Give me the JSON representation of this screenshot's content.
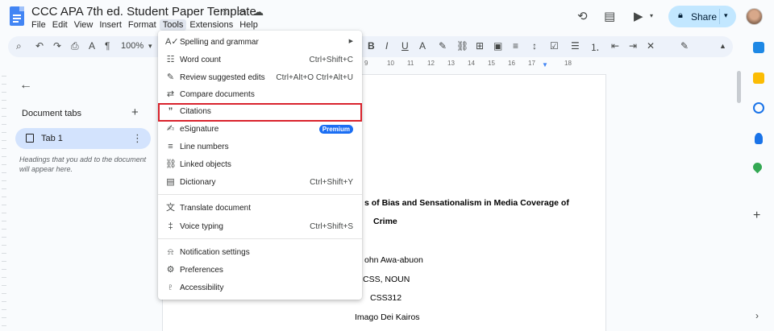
{
  "doc": {
    "title": "CCC APA 7th ed. Student Paper Template",
    "menu": [
      "File",
      "Edit",
      "View",
      "Insert",
      "Format",
      "Tools",
      "Extensions",
      "Help"
    ]
  },
  "share": {
    "label": "Share"
  },
  "toolbar": {
    "zoom": "100%"
  },
  "left_panel": {
    "tabs_title": "Document tabs",
    "tab_label": "Tab 1",
    "hint": "Headings that you add to the document will appear here."
  },
  "ruler": {
    "labels": [
      "9",
      "10",
      "11",
      "12",
      "13",
      "14",
      "15",
      "16",
      "17",
      "18"
    ]
  },
  "document": {
    "title_line1": "s of Bias and Sensationalism in Media Coverage of",
    "title_line2": "Crime",
    "author": "ohn Awa-abuon",
    "dept": "CSS, NOUN",
    "course": "CSS312",
    "instructor": "Imago Dei Kairos"
  },
  "tools_menu": {
    "items": [
      {
        "label": "Spelling and grammar",
        "shortcut": "",
        "icon": "spellcheck-icon",
        "glyph": "A✓"
      },
      {
        "label": "Word count",
        "shortcut": "Ctrl+Shift+C",
        "icon": "word-count-icon",
        "glyph": "☷"
      },
      {
        "label": "Review suggested edits",
        "shortcut": "Ctrl+Alt+O Ctrl+Alt+U",
        "icon": "review-edits-icon",
        "glyph": "✎"
      },
      {
        "label": "Compare documents",
        "shortcut": "",
        "icon": "compare-icon",
        "glyph": "⇄"
      },
      {
        "label": "Citations",
        "shortcut": "",
        "icon": "citations-icon",
        "glyph": "”"
      },
      {
        "label": "eSignature",
        "shortcut": "",
        "badge": "Premium",
        "icon": "esignature-icon",
        "glyph": "✍"
      },
      {
        "label": "Line numbers",
        "shortcut": "",
        "icon": "line-numbers-icon",
        "glyph": "≡"
      },
      {
        "label": "Linked objects",
        "shortcut": "",
        "icon": "linked-objects-icon",
        "glyph": "⛓"
      },
      {
        "label": "Dictionary",
        "shortcut": "Ctrl+Shift+Y",
        "icon": "dictionary-icon",
        "glyph": "▤"
      },
      {
        "label": "Translate document",
        "shortcut": "",
        "icon": "translate-icon",
        "glyph": "文"
      },
      {
        "label": "Voice typing",
        "shortcut": "Ctrl+Shift+S",
        "icon": "microphone-icon",
        "glyph": "‡"
      },
      {
        "label": "Notification settings",
        "shortcut": "",
        "icon": "bell-icon",
        "glyph": "⍾"
      },
      {
        "label": "Preferences",
        "shortcut": "",
        "icon": "preferences-icon",
        "glyph": "⚙"
      },
      {
        "label": "Accessibility",
        "shortcut": "",
        "icon": "accessibility-icon",
        "glyph": "♇"
      }
    ]
  },
  "colors": {
    "accent": "#c2e7ff",
    "highlight": "#d9232d",
    "badge": "#1b6ef3"
  }
}
